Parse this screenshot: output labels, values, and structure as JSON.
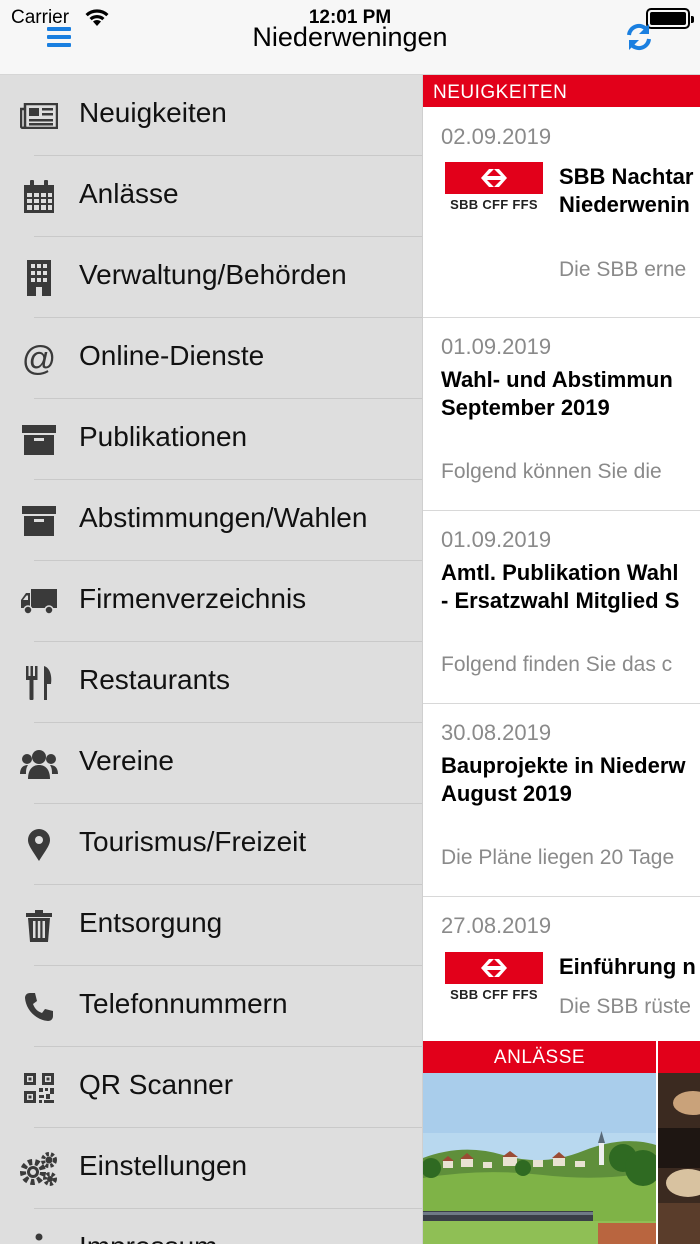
{
  "status_bar": {
    "carrier": "Carrier",
    "time": "12:01 PM"
  },
  "nav": {
    "title": "Niederweningen",
    "menu_icon": "hamburger-menu-icon",
    "refresh_icon": "refresh-icon"
  },
  "sidebar": {
    "items": [
      {
        "label": "Neuigkeiten",
        "icon": "newspaper-icon"
      },
      {
        "label": "Anlässe",
        "icon": "calendar-icon"
      },
      {
        "label": "Verwaltung/Behörden",
        "icon": "building-icon"
      },
      {
        "label": "Online-Dienste",
        "icon": "at-sign-icon"
      },
      {
        "label": "Publikationen",
        "icon": "archive-box-icon"
      },
      {
        "label": "Abstimmungen/Wahlen",
        "icon": "archive-box-icon"
      },
      {
        "label": "Firmenverzeichnis",
        "icon": "truck-icon"
      },
      {
        "label": "Restaurants",
        "icon": "cutlery-icon"
      },
      {
        "label": "Vereine",
        "icon": "users-group-icon"
      },
      {
        "label": "Tourismus/Freizeit",
        "icon": "map-pin-icon"
      },
      {
        "label": "Entsorgung",
        "icon": "trash-icon"
      },
      {
        "label": "Telefonnummern",
        "icon": "phone-icon"
      },
      {
        "label": "QR Scanner",
        "icon": "qr-code-icon"
      },
      {
        "label": "Einstellungen",
        "icon": "gears-icon"
      },
      {
        "label": "Impressum",
        "icon": "info-icon"
      }
    ]
  },
  "content": {
    "news_header": "NEUIGKEITEN",
    "news": [
      {
        "date": "02.09.2019",
        "title_1": "SBB Nachtar",
        "title_2": "Niederwenin",
        "teaser": "Die SBB erne",
        "logo": "SBB CFF FFS"
      },
      {
        "date": "01.09.2019",
        "title_1": "Wahl- und Abstimmun",
        "title_2": "September 2019",
        "teaser": "Folgend können Sie die"
      },
      {
        "date": "01.09.2019",
        "title_1": "Amtl. Publikation Wahl",
        "title_2": "- Ersatzwahl Mitglied S",
        "teaser": "Folgend finden Sie das c"
      },
      {
        "date": "30.08.2019",
        "title_1": "Bauprojekte in Niederw",
        "title_2": "August 2019",
        "teaser": "Die Pläne liegen 20 Tage"
      },
      {
        "date": "27.08.2019",
        "title_1": "Einführung n",
        "teaser": "Die SBB rüste",
        "logo": "SBB CFF FFS"
      }
    ],
    "tiles": [
      {
        "label": "ANLÄSSE"
      },
      {
        "label": ""
      }
    ]
  },
  "colors": {
    "accent": "#1a7fe0",
    "brand_red": "#e2001a",
    "sidebar_bg": "#dedede"
  }
}
